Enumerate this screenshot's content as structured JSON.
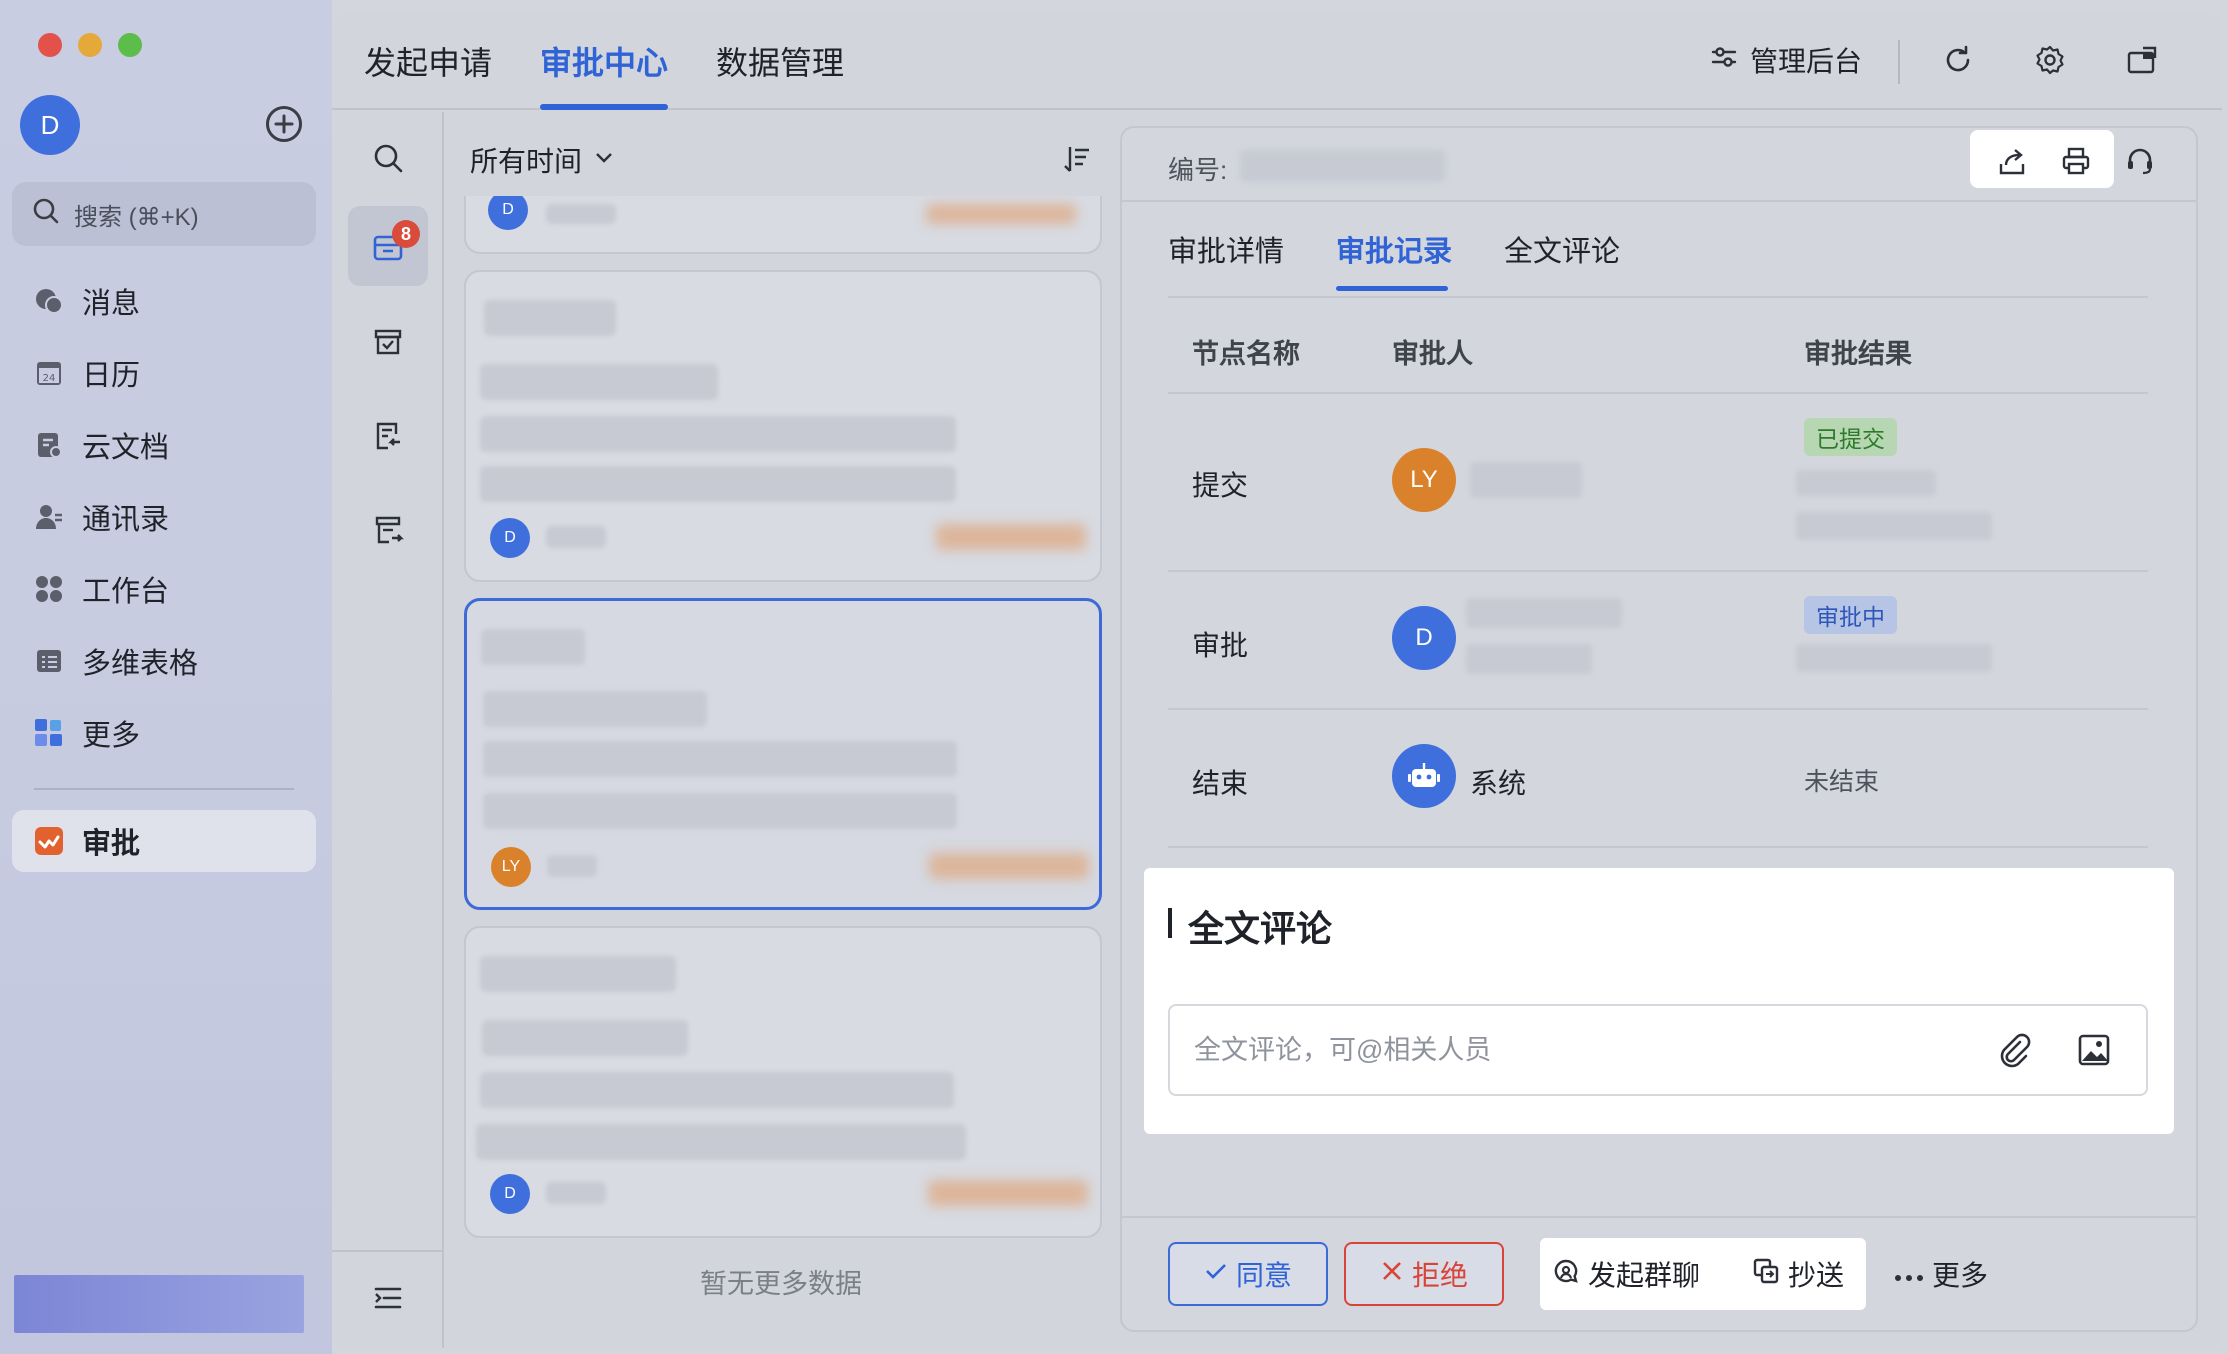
{
  "sidebar": {
    "avatar_initial": "D",
    "search_placeholder": "搜索 (⌘+K)",
    "items": [
      {
        "label": "消息",
        "icon": "message-icon"
      },
      {
        "label": "日历",
        "icon": "calendar-icon"
      },
      {
        "label": "云文档",
        "icon": "cloud-doc-icon"
      },
      {
        "label": "通讯录",
        "icon": "contacts-icon"
      },
      {
        "label": "工作台",
        "icon": "workspace-icon"
      },
      {
        "label": "多维表格",
        "icon": "table-icon"
      },
      {
        "label": "更多",
        "icon": "more-apps-icon"
      }
    ],
    "active_item": {
      "label": "审批",
      "icon": "approval-icon"
    }
  },
  "topbar": {
    "tabs": [
      "发起申请",
      "审批中心",
      "数据管理"
    ],
    "active_tab": "审批中心",
    "admin_label": "管理后台"
  },
  "icon_column": {
    "inbox_badge": "8"
  },
  "list": {
    "time_filter": "所有时间",
    "cards": [
      {
        "avatar": "D",
        "avatar_color": "#3f6fdc"
      },
      {
        "avatar": "LY",
        "avatar_color": "#d9822b"
      },
      {
        "avatar": "D",
        "avatar_color": "#3f6fdc"
      }
    ],
    "no_more_text": "暂无更多数据"
  },
  "detail": {
    "number_label": "编号:",
    "tabs": [
      "审批详情",
      "审批记录",
      "全文评论"
    ],
    "active_tab": "审批记录",
    "table": {
      "headers": [
        "节点名称",
        "审批人",
        "审批结果"
      ],
      "rows": [
        {
          "node": "提交",
          "avatar": "LY",
          "avatar_color": "#d9822b",
          "approver": "",
          "result_tag": "已提交"
        },
        {
          "node": "审批",
          "avatar": "D",
          "avatar_color": "#3f6fdc",
          "approver": "",
          "result_tag": "审批中"
        },
        {
          "node": "结束",
          "avatar": "robot",
          "avatar_color": "#3f6fdc",
          "approver": "系统",
          "result_text": "未结束"
        }
      ]
    },
    "comment": {
      "title": "全文评论",
      "placeholder": "全文评论，可@相关人员"
    },
    "footer": {
      "approve": "同意",
      "reject": "拒绝",
      "group_chat": "发起群聊",
      "cc": "抄送",
      "more": "更多"
    }
  },
  "colors": {
    "accent": "#2f63d6",
    "reject": "#d9443a",
    "badge": "#d94b3a",
    "success_tag": "#2e7a2c"
  }
}
